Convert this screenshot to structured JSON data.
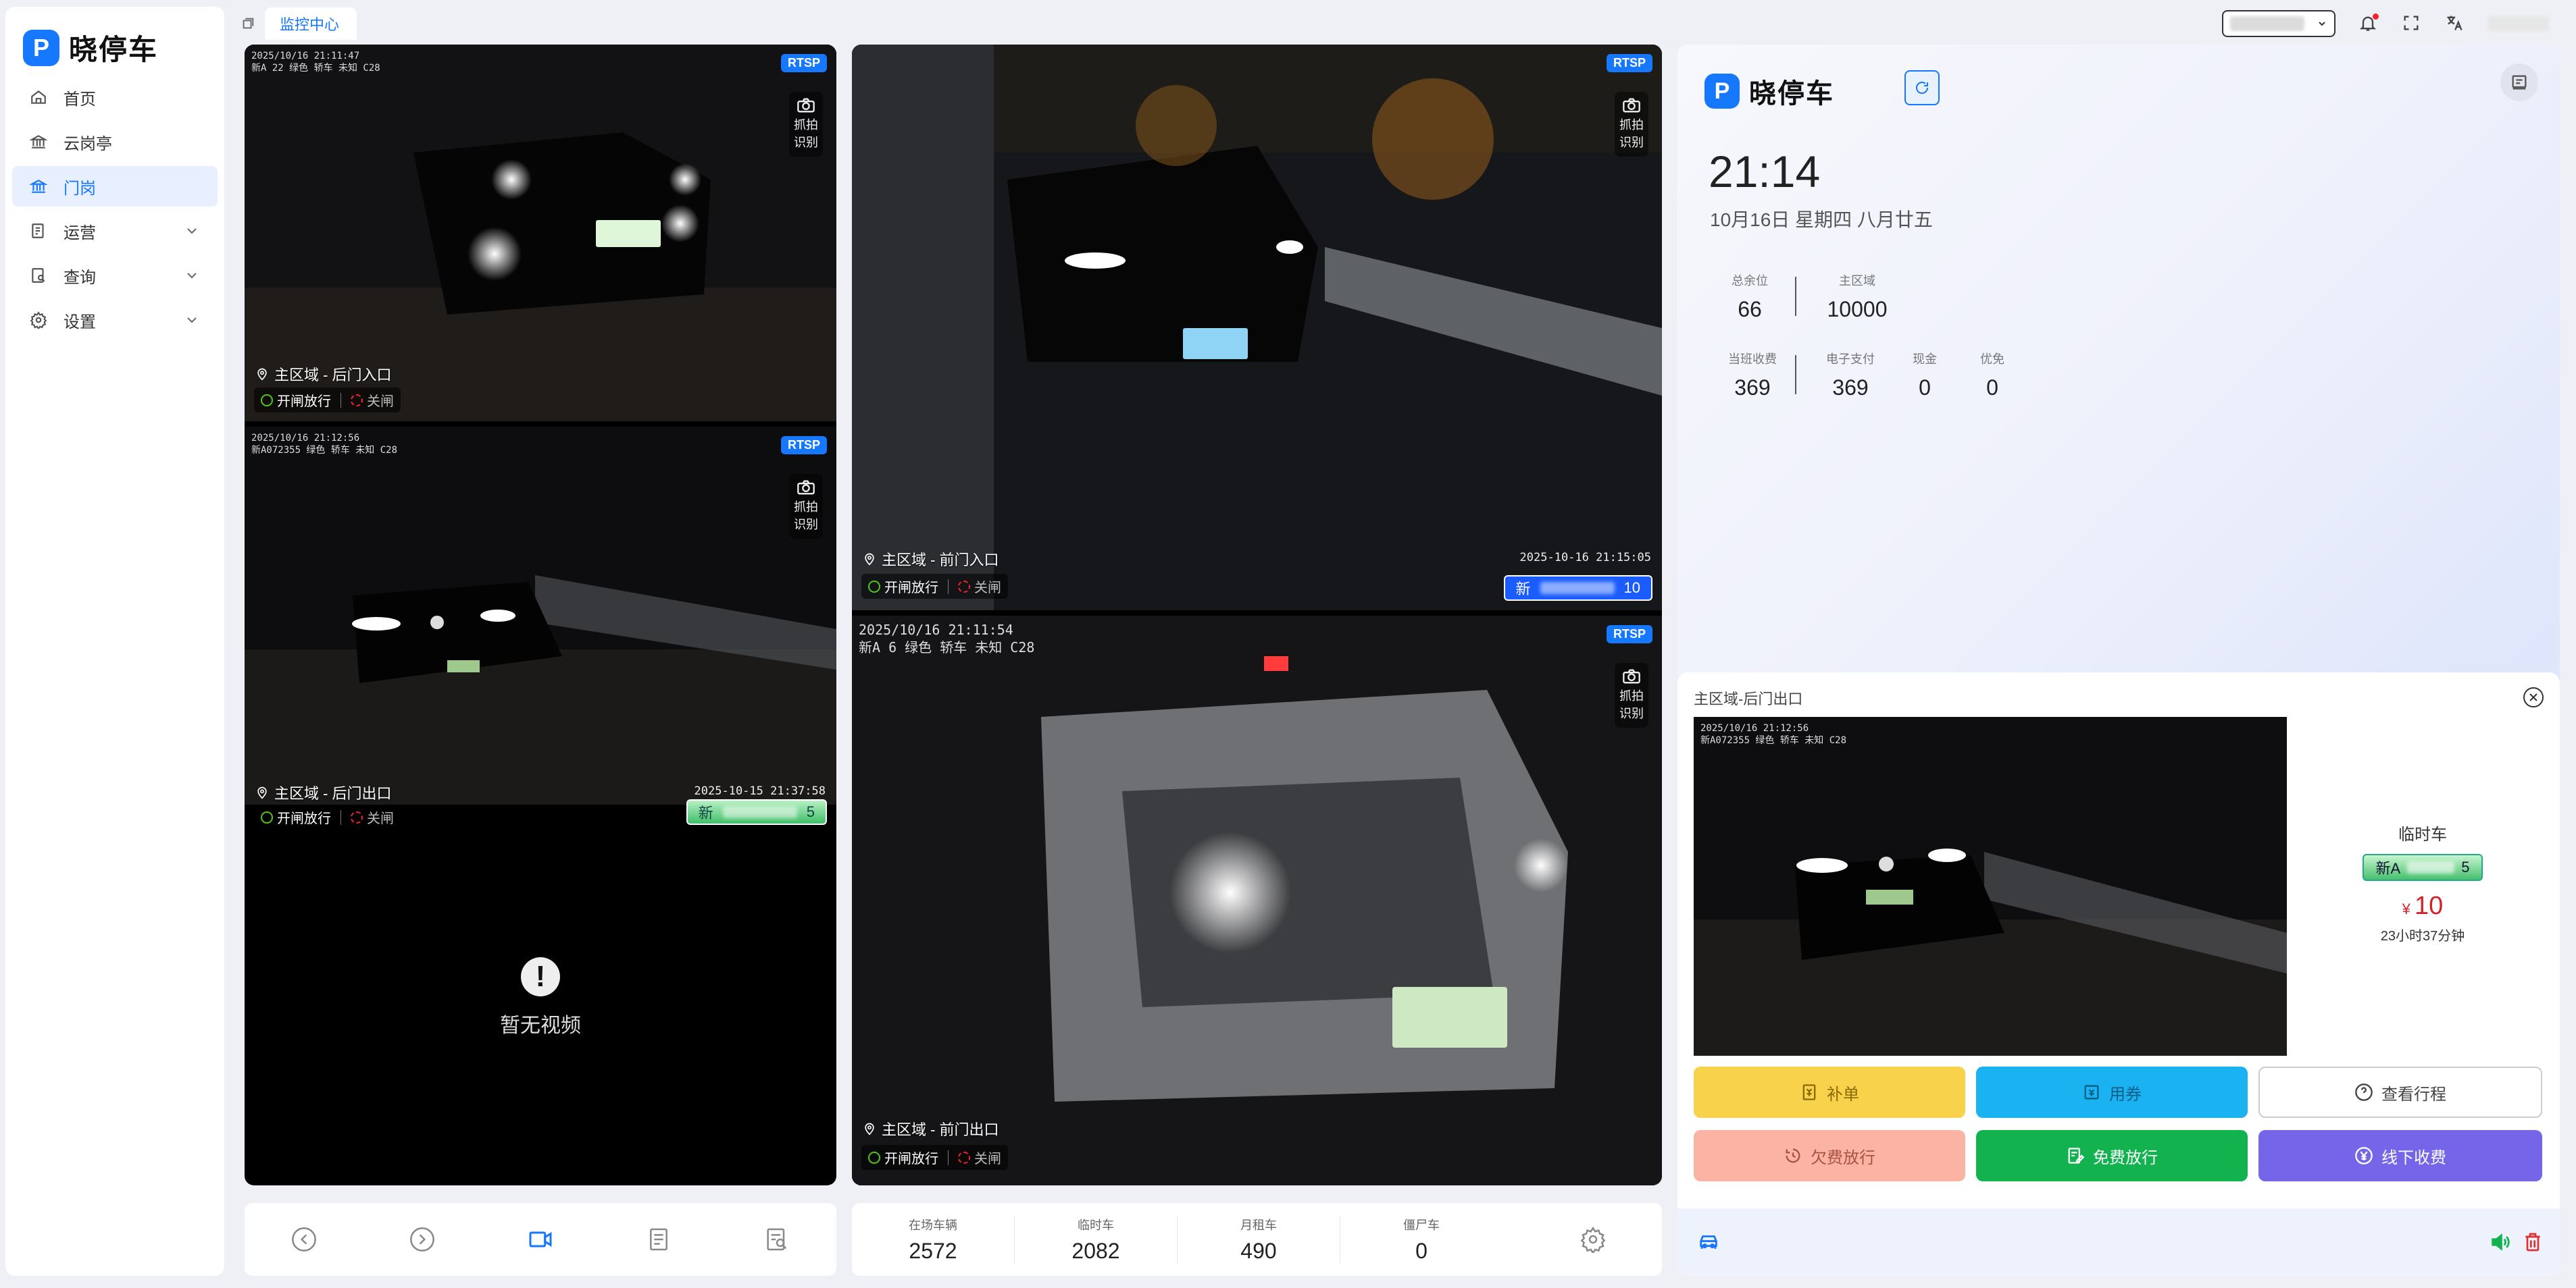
{
  "app": {
    "brand": "晓停车",
    "logo_glyph": "P"
  },
  "sidebar": {
    "items": [
      {
        "label": "首页",
        "icon": "home-icon"
      },
      {
        "label": "云岗亭",
        "icon": "bank-icon"
      },
      {
        "label": "门岗",
        "icon": "gate-icon",
        "active": true
      },
      {
        "label": "运营",
        "icon": "operation-icon",
        "expandable": true
      },
      {
        "label": "查询",
        "icon": "query-icon",
        "expandable": true
      },
      {
        "label": "设置",
        "icon": "settings-icon",
        "expandable": true
      }
    ]
  },
  "tabs": {
    "active": "监控中心"
  },
  "cameras": {
    "back_entry": {
      "stamp_line1": "2025/10/16 21:11:47",
      "stamp_line2": "新A      22 绿色 轿车 未知    C28",
      "badge": "RTSP",
      "snap_label_1": "抓拍",
      "snap_label_2": "识别",
      "name": "主区域 - 后门入口",
      "open_label": "开闸放行",
      "close_label": "关闸"
    },
    "back_exit": {
      "stamp_line1": "2025/10/16 21:12:56",
      "stamp_line2": "新A072355 绿色 轿车 未知   C28",
      "badge": "RTSP",
      "snap_label_1": "抓拍",
      "snap_label_2": "识别",
      "name": "主区域 - 后门出口",
      "open_label": "开闸放行",
      "close_label": "关闸",
      "timestamp": "2025-10-15 21:37:58",
      "plate_prefix": "新",
      "plate_suffix": "5"
    },
    "empty": {
      "text": "暂无视频",
      "glyph": "!"
    },
    "front_entry": {
      "badge": "RTSP",
      "snap_label_1": "抓拍",
      "snap_label_2": "识别",
      "name": "主区域 - 前门入口",
      "open_label": "开闸放行",
      "close_label": "关闸",
      "timestamp": "2025-10-16 21:15:05",
      "plate_prefix": "新",
      "plate_suffix": "10"
    },
    "front_exit": {
      "stamp_line1": "2025/10/16 21:11:54",
      "stamp_line2": "新A      6 绿色 轿车 未知    C28",
      "badge": "RTSP",
      "snap_label_1": "抓拍",
      "snap_label_2": "识别",
      "name": "主区域 - 前门出口",
      "open_label": "开闸放行",
      "close_label": "关闸"
    }
  },
  "stats_bar": [
    {
      "label": "在场车辆",
      "value": "2572"
    },
    {
      "label": "临时车",
      "value": "2082"
    },
    {
      "label": "月租车",
      "value": "490"
    },
    {
      "label": "僵尸车",
      "value": "0"
    }
  ],
  "panel": {
    "time": "21:14",
    "date": "10月16日 星期四 八月廿五",
    "spaces": [
      {
        "label": "总余位",
        "value": "66"
      },
      {
        "label": "主区域",
        "value": "10000"
      }
    ],
    "fees": [
      {
        "label": "当班收费",
        "value": "369"
      },
      {
        "label": "电子支付",
        "value": "369"
      },
      {
        "label": "现金",
        "value": "0"
      },
      {
        "label": "优免",
        "value": "0"
      }
    ]
  },
  "exit_card": {
    "title": "主区域-后门出口",
    "stamp_line1": "2025/10/16 21:12:56",
    "stamp_line2": "新A072355 绿色 轿车 未知   C28",
    "vehicle_type": "临时车",
    "plate_prefix": "新A",
    "plate_suffix": "5",
    "currency": "¥",
    "fee": "10",
    "duration": "23小时37分钟",
    "buttons": {
      "supplement": "补单",
      "coupon": "用券",
      "trip": "查看行程",
      "arrears": "欠费放行",
      "free": "免费放行",
      "offline": "线下收费"
    }
  }
}
